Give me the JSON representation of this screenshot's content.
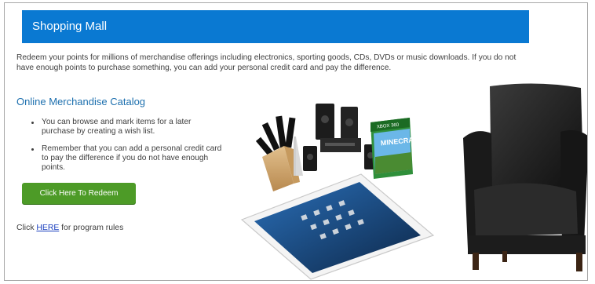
{
  "header": {
    "title": "Shopping Mall"
  },
  "intro": {
    "text": "Redeem your points for millions of merchandise offerings including electronics, sporting goods, CDs, DVDs or music downloads. If you do not have enough points to purchase something, you can add your personal credit card and pay the difference."
  },
  "catalog": {
    "title": "Online Merchandise Catalog",
    "bullets": [
      "You can browse and mark items for a later purchase by creating a wish list.",
      "Remember that you can add a personal credit card to pay the difference if you do not have enough points."
    ],
    "redeem_label": "Click Here To Redeem"
  },
  "rules": {
    "prefix": "Click ",
    "link": "HERE",
    "suffix": " for program rules"
  },
  "product_image": {
    "box_art_text": "MINECRAFT",
    "box_platform_text": "XBOX 360"
  },
  "colors": {
    "header_bg": "#0a79d2",
    "link": "#1a3fbf",
    "section_title": "#1c6fae",
    "button": "#4d9b27"
  }
}
